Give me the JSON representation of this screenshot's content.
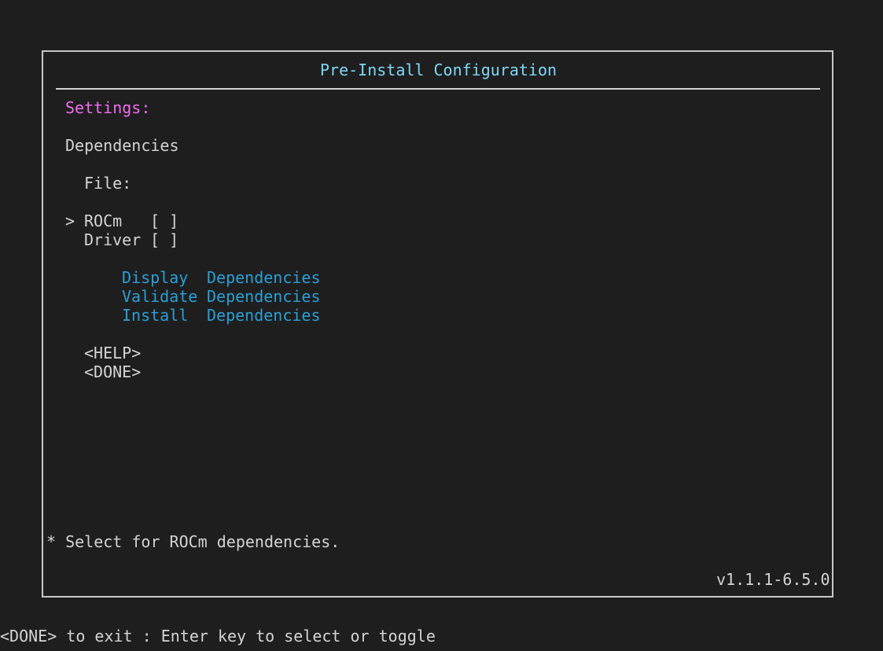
{
  "dialog": {
    "title": "Pre-Install Configuration"
  },
  "settings": {
    "heading": "Settings:",
    "section": "Dependencies",
    "file_label": "File:"
  },
  "options": [
    {
      "cursor": ">",
      "label": "ROCm",
      "checkbox": "[ ]",
      "selected": true
    },
    {
      "cursor": "",
      "label": "Driver",
      "checkbox": "[ ]",
      "selected": false
    }
  ],
  "actions": {
    "display": {
      "verb": "Display",
      "noun": "Dependencies"
    },
    "validate": {
      "verb": "Validate",
      "noun": "Dependencies"
    },
    "install": {
      "verb": "Install",
      "noun": "Dependencies"
    }
  },
  "buttons": {
    "help": "<HELP>",
    "done": "<DONE>"
  },
  "hint": "* Select for ROCm dependencies.",
  "version": "v1.1.1-6.5.0",
  "statusbar": "<DONE> to exit : Enter key to select or toggle",
  "colors": {
    "background": "#1e1e1e",
    "text": "#d4d4d4",
    "title": "#7fd7f5",
    "heading": "#f26bf0",
    "link": "#2a9fd6",
    "border": "#c8c8c8"
  }
}
